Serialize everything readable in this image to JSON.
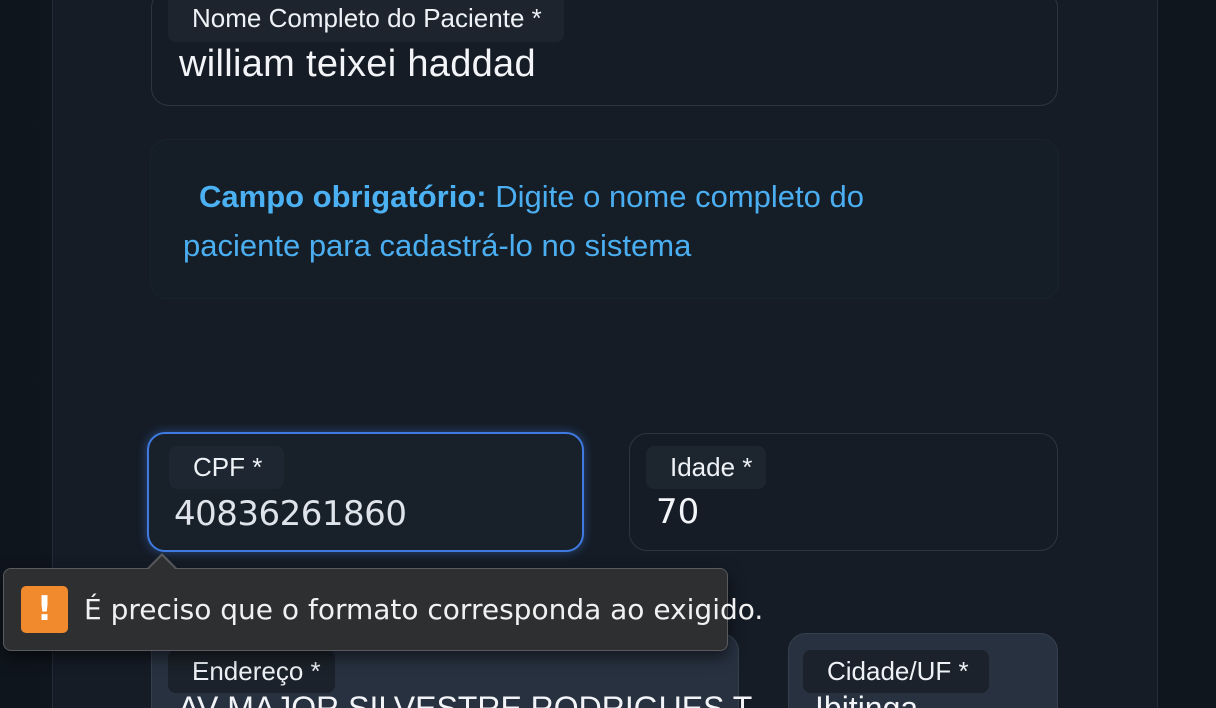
{
  "form": {
    "nome": {
      "label": "Nome Completo do Paciente *",
      "value": "william teixei haddad"
    },
    "hint": {
      "strong": "Campo obrigatório:",
      "text": " Digite o nome completo do paciente para cadastrá-lo no sistema"
    },
    "cpf": {
      "label": "CPF *",
      "value": "40836261860"
    },
    "idade": {
      "label": "Idade *",
      "value": "70"
    },
    "endereco": {
      "label": "Endereço *",
      "value": "AV MAJOR SILVESTRE RODRIGUES T"
    },
    "cidade": {
      "label": "Cidade/UF *",
      "value": "Ibitinga"
    }
  },
  "validation_tooltip": {
    "icon": "warning-icon",
    "icon_glyph": "!",
    "message": "É preciso que o formato corresponda ao exigido."
  },
  "colors": {
    "accent_blue": "#3e7ae0",
    "hint_text": "#4aaef0",
    "warning_orange": "#f08a2c"
  }
}
